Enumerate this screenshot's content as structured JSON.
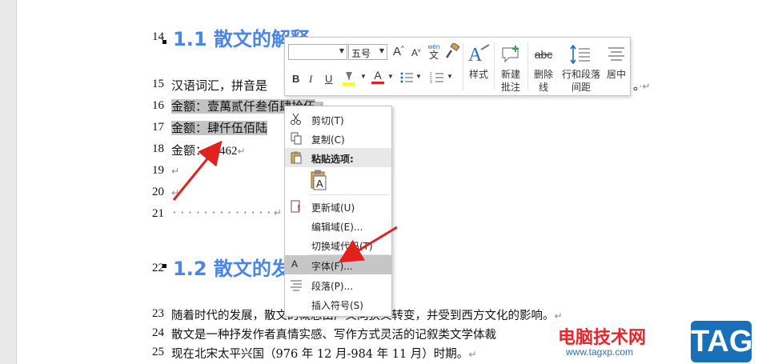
{
  "document": {
    "heading1": "1.1 散文的解释",
    "heading2": "1.2 散文的发",
    "line_numbers": [
      "14",
      "15",
      "16",
      "17",
      "18",
      "19",
      "20",
      "21",
      "22",
      "23",
      "24",
      "25"
    ],
    "lines": {
      "l15": "汉语词汇，拼音是",
      "l15_tail": "。",
      "l16_label": "金额：",
      "l16_value": "壹萬贰仟叁佰肆拾伍",
      "l17_label": "金额：",
      "l17_value": "肆仟伍佰陆",
      "l18_label": "金额：",
      "l18_value": "45462",
      "l23": "随着时代的发展，散文的概念由广义向狭义转变，并受到西方文化的影响。",
      "l24": "散文是一种抒发作者真情实感、写作方式灵活的记叙类文学体裁",
      "l25": "现在北宋太平兴国（976 年 12 月-984 年 11 月）时期。"
    },
    "para_mark": "↵",
    "dots": "·············"
  },
  "mini_toolbar": {
    "font_name": "",
    "font_size": "五号",
    "grow_font": "A",
    "shrink_font": "A",
    "phonetic_top": "wén",
    "phonetic_bottom": "文",
    "bold": "B",
    "italic": "I",
    "underline": "U",
    "font_color": "A",
    "styles_label": "样式",
    "new_comment_label1": "新建",
    "new_comment_label2": "批注",
    "strike_label1": "删除",
    "strike_label2": "线",
    "strike_icon_text": "abc",
    "spacing_label1": "行和段落",
    "spacing_label2": "间距",
    "center_label": "居中"
  },
  "context_menu": {
    "cut": "剪切(T)",
    "copy": "复制(C)",
    "paste_options": "粘贴选项:",
    "update_field": "更新域(U)",
    "edit_field": "编辑域(E)...",
    "toggle_codes": "切换域代码(T)",
    "font": "字体(F)...",
    "paragraph": "段落(P)...",
    "insert_symbol": "插入符号(S)"
  },
  "watermark": {
    "site": "电脑技术网",
    "url": "www.tagxp.com",
    "tag": "TAG"
  },
  "colors": {
    "heading": "#4a86e8",
    "selection": "#c3c3c3",
    "menu_highlight": "#c6c6c6",
    "arrow": "#e0211c",
    "highlight_yellow": "#ffff00",
    "font_red": "#e02020"
  }
}
